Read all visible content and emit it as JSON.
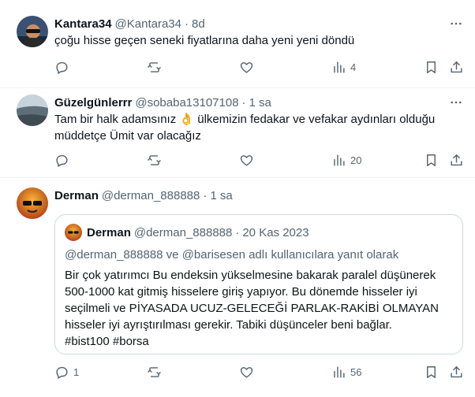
{
  "tweets": [
    {
      "name": "Kantara34",
      "handle": "@Kantara34",
      "separator": "·",
      "time": "8d",
      "text": "çoğu hisse geçen seneki fiyatlarına daha yeni yeni döndü",
      "counts": {
        "reply": "",
        "repost": "",
        "like": "",
        "views": "4"
      }
    },
    {
      "name": "Güzelgünlerrr",
      "handle": "@sobaba13107108",
      "separator": "·",
      "time": "1 sa",
      "text_before": "Tam bir halk adamsınız ",
      "emoji": "👌",
      "text_after": " ülkemizin fedakar ve vefakar aydınları olduğu müddetçe Ümit var olacağız",
      "counts": {
        "reply": "",
        "repost": "",
        "like": "",
        "views": "20"
      }
    },
    {
      "name": "Derman",
      "handle": "@derman_888888",
      "separator": "·",
      "time": "1 sa",
      "quote": {
        "name": "Derman",
        "handle": "@derman_888888",
        "separator": "·",
        "time": "20 Kas 2023",
        "reply_context": "@derman_888888 ve @barisesen adlı kullanıcılara yanıt olarak",
        "text": "Bir çok yatırımcı Bu endeksin yükselmesine bakarak paralel düşünerek 500-1000 kat gitmiş hisselere giriş yapıyor. Bu dönemde hisseler iyi seçilmeli ve PİYASADA UCUZ-GELECEĞİ PARLAK-RAKİBİ OLMAYAN hisseler iyi ayrıştırılması gerekir. Tabiki düşünceler beni bağlar.",
        "hashtags": "#bist100 #borsa"
      },
      "counts": {
        "reply": "1",
        "repost": "",
        "like": "",
        "views": "56"
      }
    }
  ],
  "icons": {
    "reply": "reply-icon",
    "repost": "repost-icon",
    "like": "like-icon",
    "views": "views-icon",
    "bookmark": "bookmark-icon",
    "share": "share-icon",
    "more": "more-icon"
  },
  "colors": {
    "text": "#0f1419",
    "secondary": "#536471",
    "border": "#cfd9de",
    "divider": "#eff3f4"
  }
}
